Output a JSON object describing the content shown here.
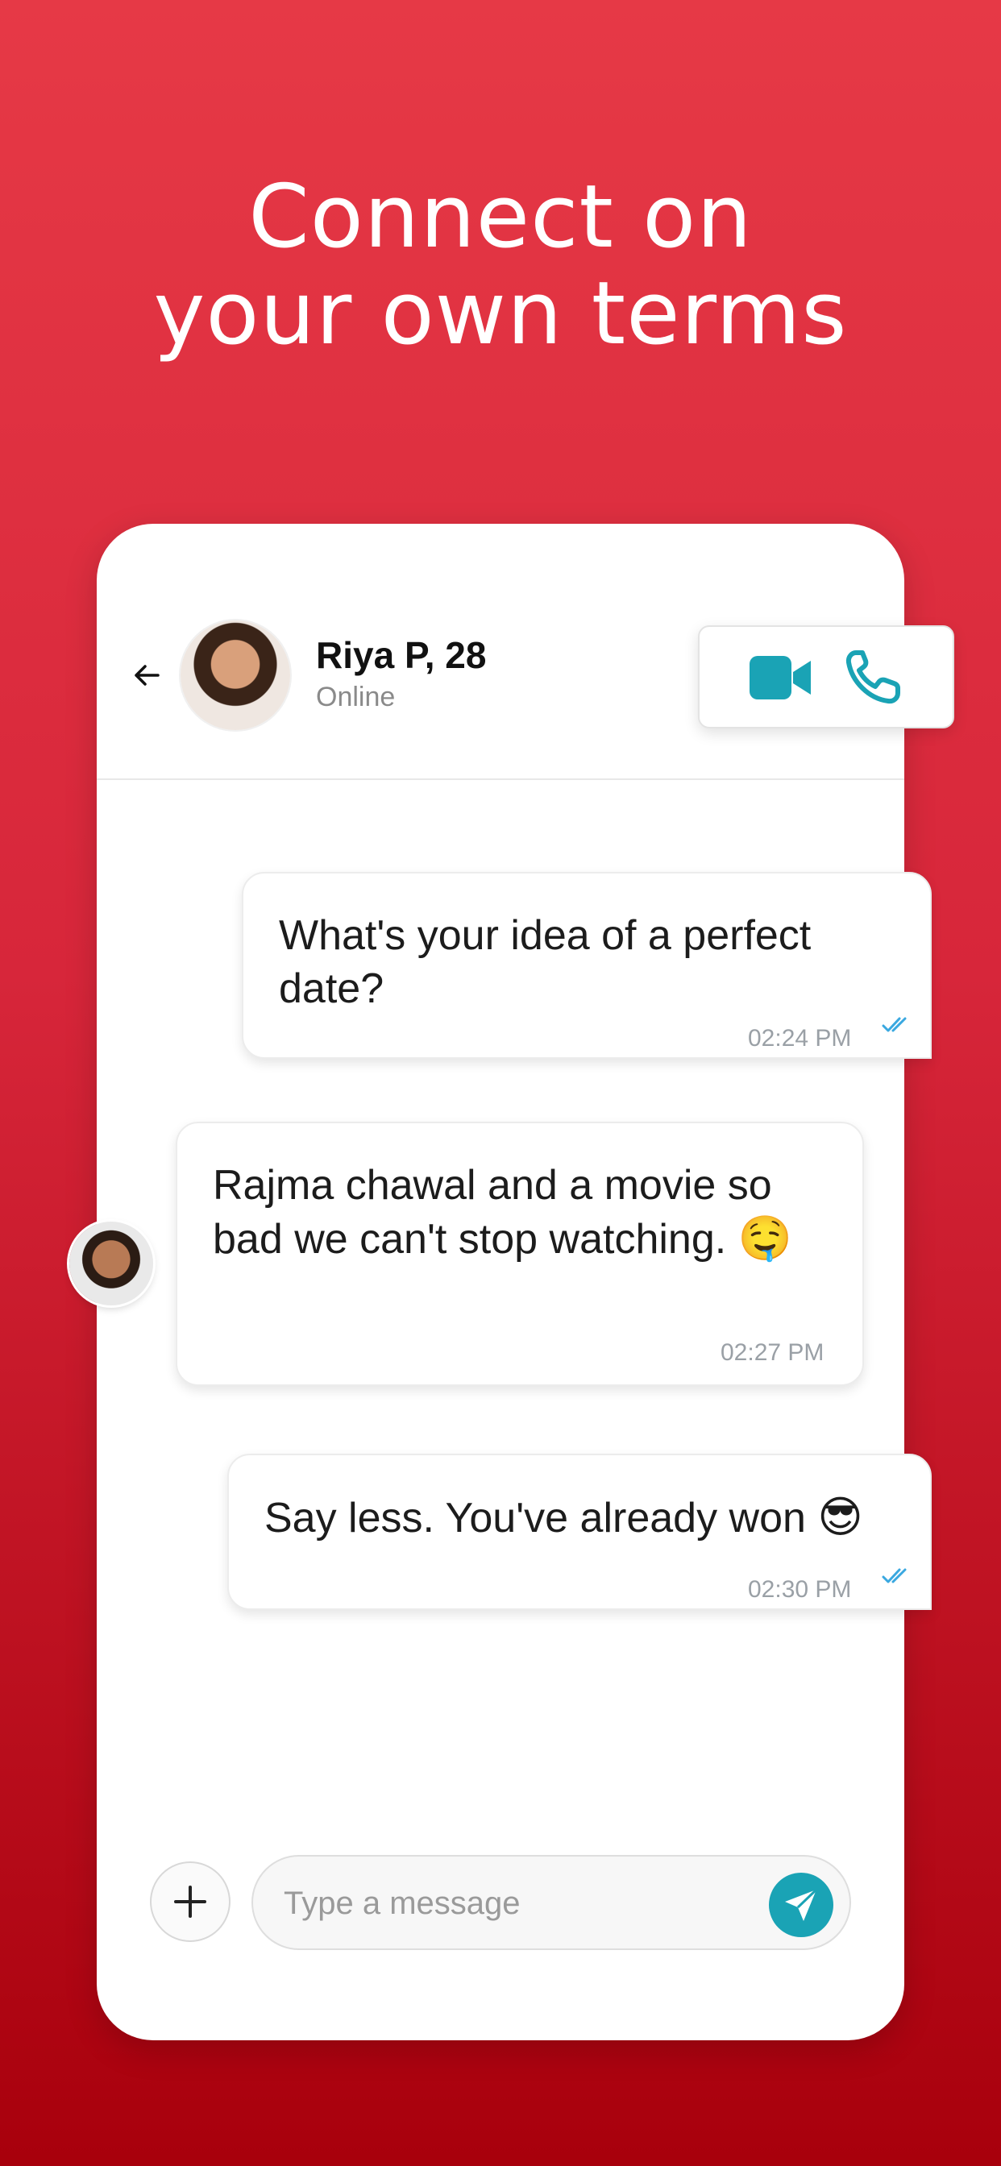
{
  "headline": {
    "line1": "Connect on",
    "line2": "your own terms"
  },
  "chat": {
    "contact_name": "Riya P, 28",
    "contact_status": "Online",
    "messages": [
      {
        "direction": "outgoing",
        "text": "What's your idea of a perfect date?",
        "time": "02:24 PM",
        "read": true
      },
      {
        "direction": "incoming",
        "text": "Rajma chawal and a movie so bad we can't stop watching.",
        "emoji": "🤤",
        "time": "02:27 PM"
      },
      {
        "direction": "outgoing",
        "text": "Say less. You've already won",
        "emoji": "😎",
        "time": "02:30 PM",
        "read": true
      }
    ],
    "input_placeholder": "Type a message"
  },
  "icons": {
    "back": "arrow-left-icon",
    "video": "video-camera-icon",
    "call": "phone-icon",
    "attach": "plus-icon",
    "send": "send-icon",
    "read": "double-check-icon"
  },
  "colors": {
    "background_top": "#e63946",
    "background_bottom": "#a8000c",
    "accent": "#1aa3b5",
    "read_tick": "#3aa8e0"
  }
}
